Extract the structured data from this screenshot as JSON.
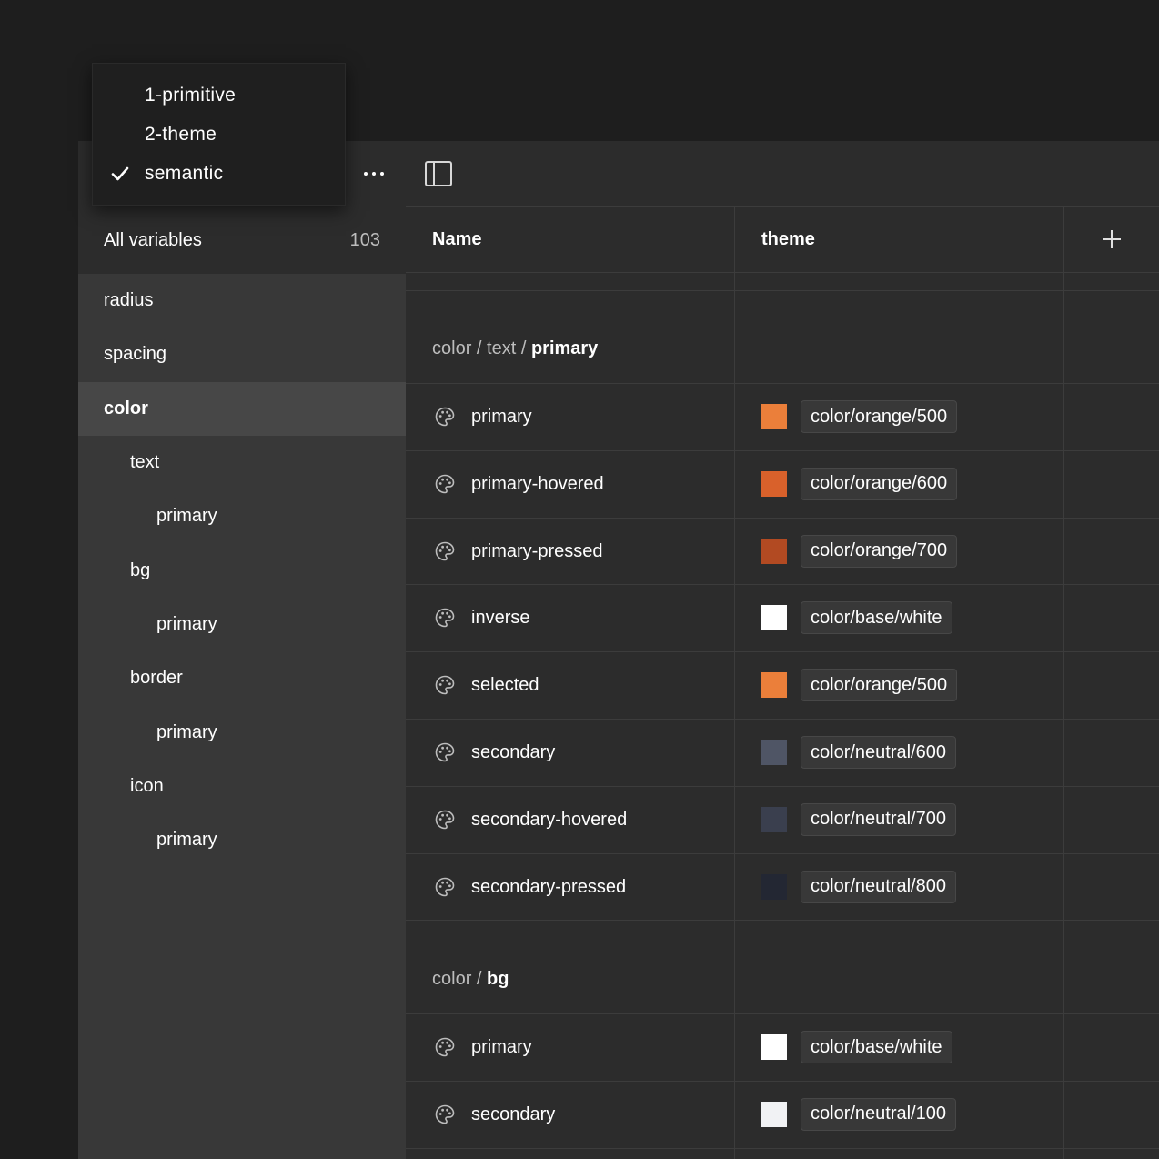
{
  "mode_menu": {
    "items": [
      {
        "label": "1-primitive",
        "checked": false
      },
      {
        "label": "2-theme",
        "checked": false
      },
      {
        "label": "semantic",
        "checked": true
      }
    ]
  },
  "sidebar": {
    "more_icon": "more-horizontal-icon",
    "all_variables_label": "All variables",
    "all_variables_count": "103",
    "groups": [
      {
        "label": "radius",
        "level": 0
      },
      {
        "label": "spacing",
        "level": 0
      },
      {
        "label": "color",
        "level": 0,
        "active": true
      },
      {
        "label": "text",
        "level": 1
      },
      {
        "label": "primary",
        "level": 2
      },
      {
        "label": "bg",
        "level": 1
      },
      {
        "label": "primary",
        "level": 2
      },
      {
        "label": "border",
        "level": 1
      },
      {
        "label": "primary",
        "level": 2
      },
      {
        "label": "icon",
        "level": 1
      },
      {
        "label": "primary",
        "level": 2
      }
    ]
  },
  "table": {
    "toolbar_icon": "sidebar-panel-icon",
    "columns": {
      "name": "Name",
      "theme": "theme",
      "add_icon": "plus-icon"
    },
    "sections": [
      {
        "path_prefix": "color / text / ",
        "path_current": "primary",
        "rows": [
          {
            "name": "primary",
            "swatch": "#eb7f3a",
            "alias": "color/orange/500"
          },
          {
            "name": "primary-hovered",
            "swatch": "#d9612b",
            "alias": "color/orange/600"
          },
          {
            "name": "primary-pressed",
            "swatch": "#b24a22",
            "alias": "color/orange/700"
          },
          {
            "name": "inverse",
            "swatch": "#ffffff",
            "alias": "color/base/white"
          },
          {
            "name": "selected",
            "swatch": "#eb7f3a",
            "alias": "color/orange/500"
          },
          {
            "name": "secondary",
            "swatch": "#4f5565",
            "alias": "color/neutral/600"
          },
          {
            "name": "secondary-hovered",
            "swatch": "#3a3f4e",
            "alias": "color/neutral/700"
          },
          {
            "name": "secondary-pressed",
            "swatch": "#232733",
            "alias": "color/neutral/800"
          }
        ]
      },
      {
        "path_prefix": "color / ",
        "path_current": "bg",
        "rows": [
          {
            "name": "primary",
            "swatch": "#ffffff",
            "alias": "color/base/white"
          },
          {
            "name": "secondary",
            "swatch": "#f1f2f4",
            "alias": "color/neutral/100"
          }
        ]
      }
    ],
    "row_icon": "palette-icon"
  }
}
